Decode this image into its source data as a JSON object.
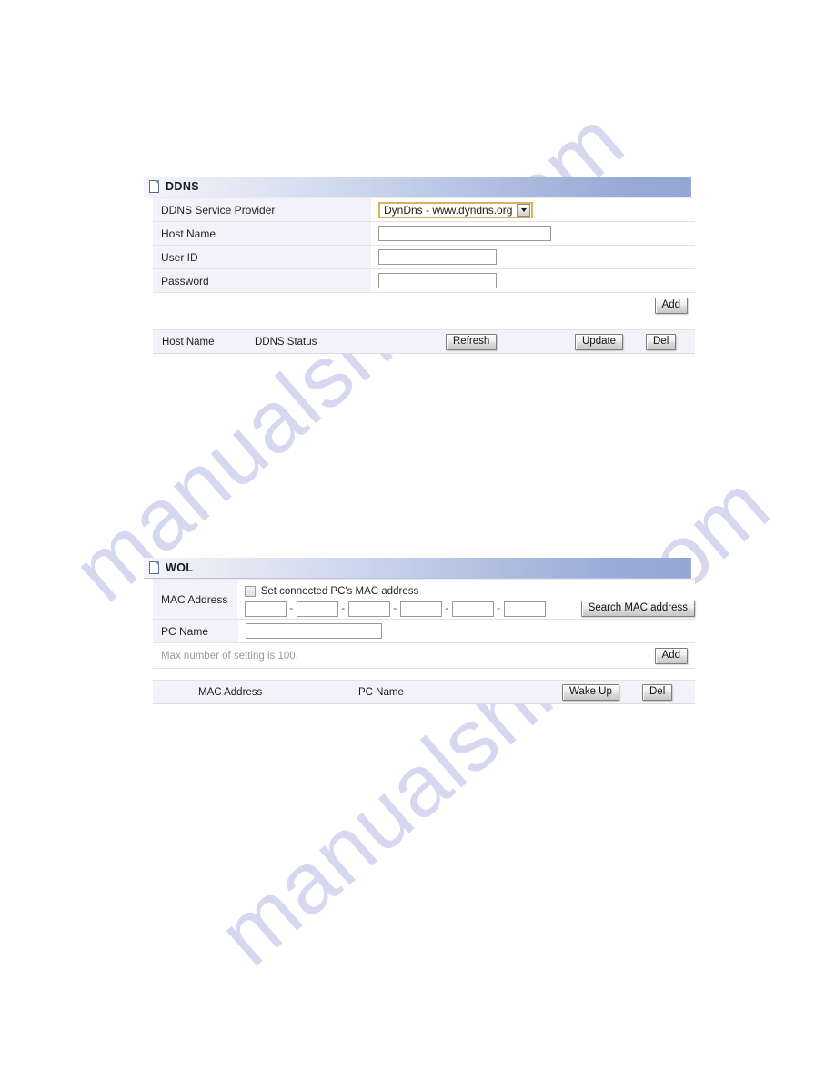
{
  "watermark": {
    "line1": "manualshive.com",
    "line2": "manualshive.com",
    "color": "#c9cbec"
  },
  "theme": {
    "header_gradient_start": "#f4f5fa",
    "header_gradient_end": "#93a6d5",
    "label_cell_bg": "#f2f2f8",
    "select_border": "#d7b45a",
    "button_face": "#dcdcdc",
    "note_text": "#9a9a9a"
  },
  "ddns": {
    "title": "DDNS",
    "icon": "page-icon",
    "rows": [
      {
        "label": "DDNS Service Provider",
        "control": "select",
        "value": "DynDns - www.dyndns.org"
      },
      {
        "label": "Host Name",
        "control": "text",
        "value": "",
        "placeholder": ""
      },
      {
        "label": "User ID",
        "control": "text",
        "value": "",
        "placeholder": ""
      },
      {
        "label": "Password",
        "control": "text",
        "value": "",
        "placeholder": ""
      }
    ],
    "add_label": "Add",
    "list": {
      "columns": [
        "Host Name",
        "DDNS Status"
      ],
      "refresh_label": "Refresh",
      "update_label": "Update",
      "del_label": "Del",
      "rows": []
    }
  },
  "wol": {
    "title": "WOL",
    "icon": "page-icon",
    "mac_label": "MAC Address",
    "checkbox_label": "Set connected PC's MAC address",
    "checkbox_checked": false,
    "mac_octets": [
      "",
      "",
      "",
      "",
      "",
      ""
    ],
    "mac_separator": "-",
    "search_label": "Search MAC address",
    "pcname_label": "PC Name",
    "pcname_value": "",
    "note": "Max number of setting is 100.",
    "add_label": "Add",
    "list": {
      "columns": [
        "MAC Address",
        "PC Name"
      ],
      "wake_label": "Wake Up",
      "del_label": "Del",
      "rows": []
    }
  }
}
